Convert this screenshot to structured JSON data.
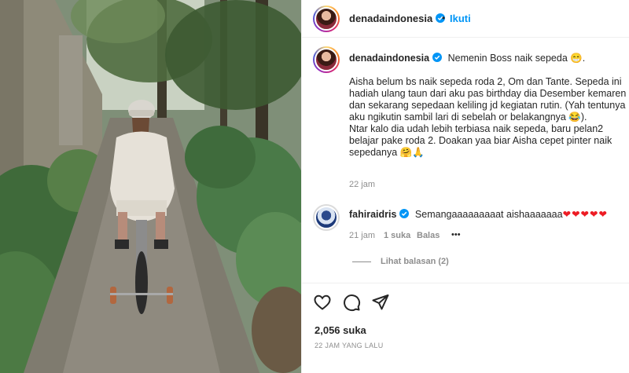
{
  "photo": {
    "alt": "",
    "icon": "photo-scene"
  },
  "header": {
    "username": "denadaindonesia",
    "separator": "•",
    "follow_label": "Ikuti",
    "verified_icon": "verified-badge-icon"
  },
  "caption": {
    "username": "denadaindonesia",
    "first_line": "Nemenin Boss naik sepeda 😁.",
    "lines": [
      "Aisha belum bs naik sepeda roda 2, Om dan Tante. Sepeda ini",
      "hadiah ulang taun dari aku pas birthday dia Desember kemaren",
      "dan sekarang sepedaan keliling jd kegiatan rutin. (Yah tentunya",
      "aku ngikutin sambil lari di sebelah or belakangnya 😂).",
      "Ntar kalo dia udah lebih terbiasa naik sepeda, baru pelan2",
      "belajar pake roda 2. Doakan yaa biar Aisha cepet pinter naik",
      "sepedanya 🤗🙏"
    ],
    "time": "22 jam"
  },
  "comment": {
    "username": "fahiraidris",
    "text": "Semangaaaaaaaaat aishaaaaaaa",
    "hearts": "❤❤❤❤❤",
    "time": "21 jam",
    "likes": "1 suka",
    "reply_label": "Balas",
    "more_label": "•••",
    "view_replies": "Lihat balasan (2)"
  },
  "actions": {
    "like_icon": "heart-icon",
    "comment_icon": "comment-icon",
    "share_icon": "share-icon",
    "likes_count": "2,056 suka",
    "time_ago": "22 JAM YANG LALU"
  },
  "colors": {
    "accent": "#0095f6",
    "verified": "#0095f6",
    "text": "#262626",
    "muted": "#8e8e8e",
    "border": "#efefef",
    "heart": "#ed1c24"
  }
}
